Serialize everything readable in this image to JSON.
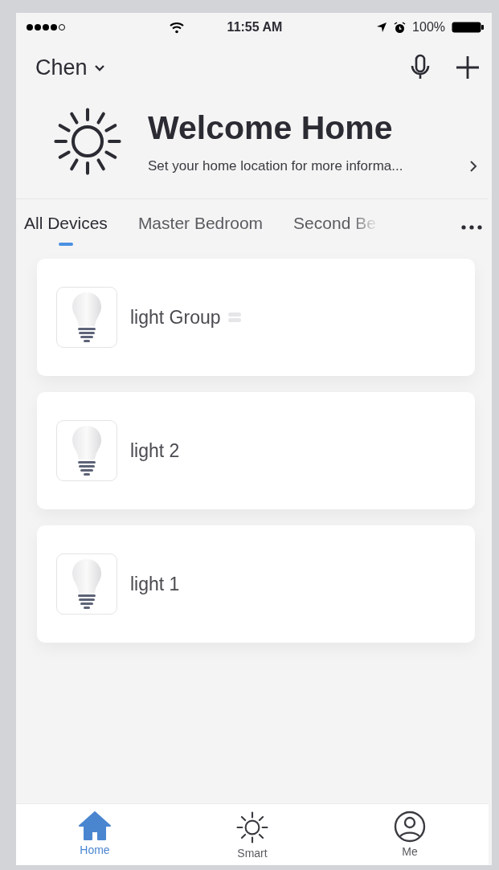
{
  "status_bar": {
    "time": "11:55 AM",
    "battery": "100%"
  },
  "header": {
    "home_name": "Chen"
  },
  "welcome": {
    "title": "Welcome Home",
    "subtitle": "Set your home location for more informa..."
  },
  "tabs": [
    {
      "label": "All Devices",
      "selected": true
    },
    {
      "label": "Master Bedroom",
      "selected": false
    },
    {
      "label": "Second Be",
      "selected": false
    }
  ],
  "devices": [
    {
      "name": "light Group",
      "kind": "group"
    },
    {
      "name": "light 2",
      "kind": "device"
    },
    {
      "name": "light 1",
      "kind": "device"
    }
  ],
  "nav": [
    {
      "label": "Home",
      "kind": "home",
      "selected": true
    },
    {
      "label": "Smart",
      "kind": "smart",
      "selected": false
    },
    {
      "label": "Me",
      "kind": "me",
      "selected": false
    }
  ]
}
